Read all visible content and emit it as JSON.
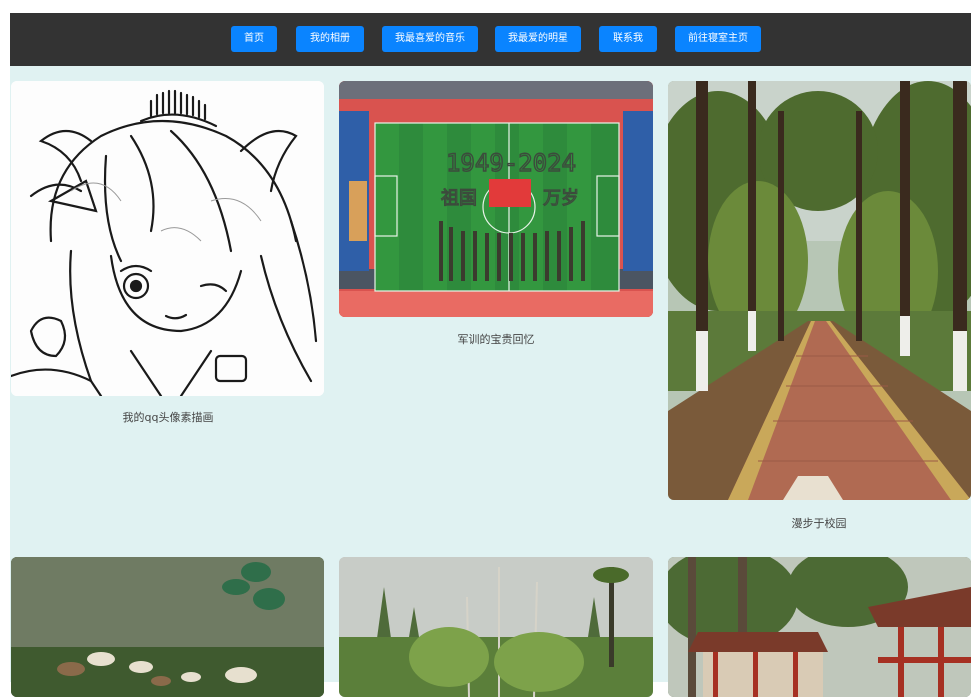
{
  "nav": {
    "items": [
      {
        "label": "首页"
      },
      {
        "label": "我的相册"
      },
      {
        "label": "我最喜爱的音乐"
      },
      {
        "label": "我最爱的明星"
      },
      {
        "label": "联系我"
      },
      {
        "label": "前往寝室主页"
      }
    ]
  },
  "gallery": {
    "photos": [
      {
        "caption": "我的qq头像素描画",
        "icon": "anime-sketch-image"
      },
      {
        "caption": "军训的宝贵回忆",
        "icon": "stadium-aerial-image",
        "image_text": "1949-2024 祖国 万岁"
      },
      {
        "caption": "漫步于校园",
        "icon": "tree-lined-path-image"
      },
      {
        "caption": "",
        "icon": "pond-ducks-image"
      },
      {
        "caption": "",
        "icon": "reeds-image"
      },
      {
        "caption": "",
        "icon": "pavilion-image"
      }
    ]
  },
  "colors": {
    "nav_bg": "#333333",
    "button": "#0a84ff",
    "content_bg": "#e0f2f2"
  }
}
